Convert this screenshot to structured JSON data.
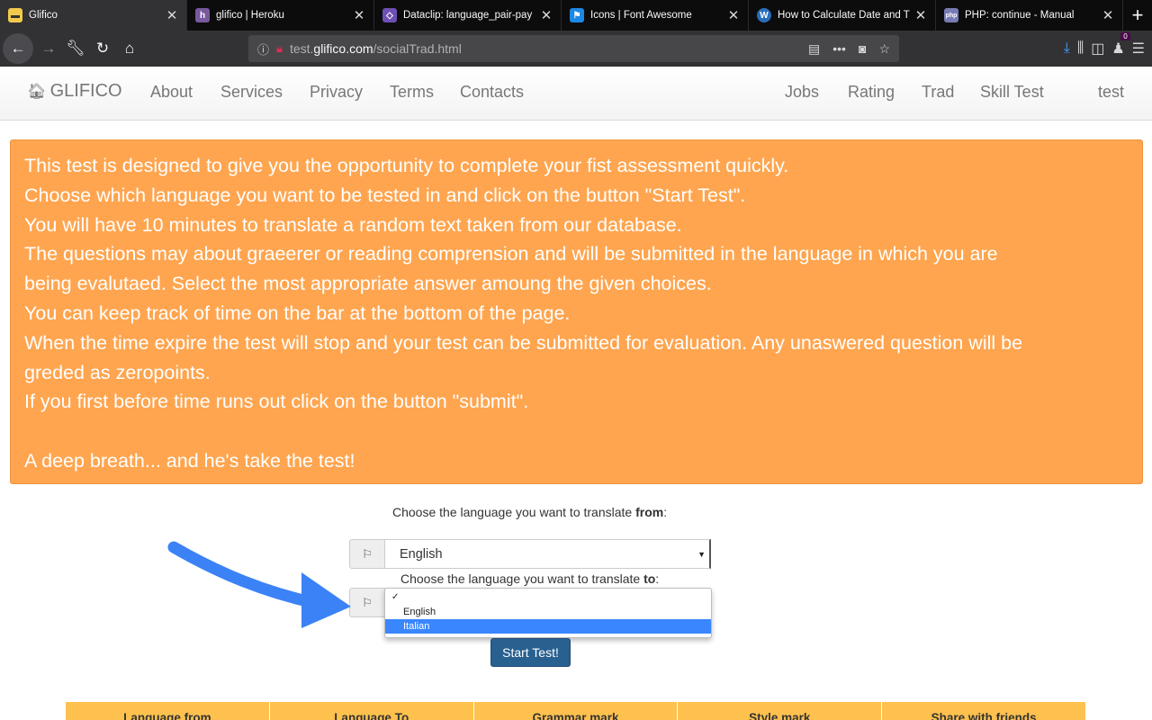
{
  "browser": {
    "tabs": [
      {
        "title": "Glifico",
        "active": true,
        "icon": "glifico-favicon",
        "color": "#f2c94c"
      },
      {
        "title": "glifico | Heroku",
        "active": false,
        "icon": "heroku-favicon",
        "color": "#79589f"
      },
      {
        "title": "Dataclip: language_pair-pay",
        "active": false,
        "icon": "dataclip-favicon",
        "color": "#6e4fb3"
      },
      {
        "title": "Icons | Font Awesome",
        "active": false,
        "icon": "fontawesome-favicon",
        "color": "#1c88e6"
      },
      {
        "title": "How to Calculate Date and T",
        "active": false,
        "icon": "w-favicon",
        "color": "#2a6ebb"
      },
      {
        "title": "PHP: continue - Manual",
        "active": false,
        "icon": "php-favicon",
        "color": "#777bb3"
      }
    ],
    "url_prefix": "test.",
    "url_host": "glifico.com",
    "url_path": "/socialTrad.html",
    "notification_count": "0"
  },
  "site": {
    "brand": "GLIFICO",
    "nav_left": [
      "About",
      "Services",
      "Privacy",
      "Terms",
      "Contacts"
    ],
    "nav_right": [
      "Jobs",
      "Rating",
      "Trad",
      "Skill Test",
      "test"
    ]
  },
  "info": {
    "lines": [
      "This test is designed to give you the opportunity to complete your fist assessment quickly.",
      "Choose which language you want to be tested in and click on the button \"Start Test\".",
      "You will have 10 minutes to translate a random text taken from our database.",
      "The questions may about graeerer or reading comprension and will be submitted in the language in which you are",
      "being evalutaed. Select the most appropriate answer amoung the given choices.",
      "You can keep track of time on the bar at the bottom of the page.",
      "When the time expire the test will stop and your test can be submitted for evaluation. Any unaswered question will be",
      "greded as zeropoints.",
      "If you first before time runs out click on the button \"submit\"."
    ],
    "closing": "A deep breath... and he's take the test!"
  },
  "form": {
    "from_label_prefix": "Choose the language you want to translate ",
    "from_label_bold": "from",
    "from_label_suffix": ":",
    "from_value": "English",
    "to_label_prefix": "Choose the language you want to translate ",
    "to_label_bold": "to",
    "to_label_suffix": ":",
    "to_options": [
      "English",
      "Italian"
    ],
    "to_highlighted": "Italian",
    "start_button": "Start Test!"
  },
  "table": {
    "headers": [
      "Language from",
      "Language To",
      "Grammar mark",
      "Style mark",
      "Share with friends"
    ]
  },
  "colors": {
    "panel": "#ffa54f",
    "button": "#286090",
    "table_header": "#ffc14e",
    "arrow": "#3b82f6",
    "highlight": "#3a86ff"
  }
}
